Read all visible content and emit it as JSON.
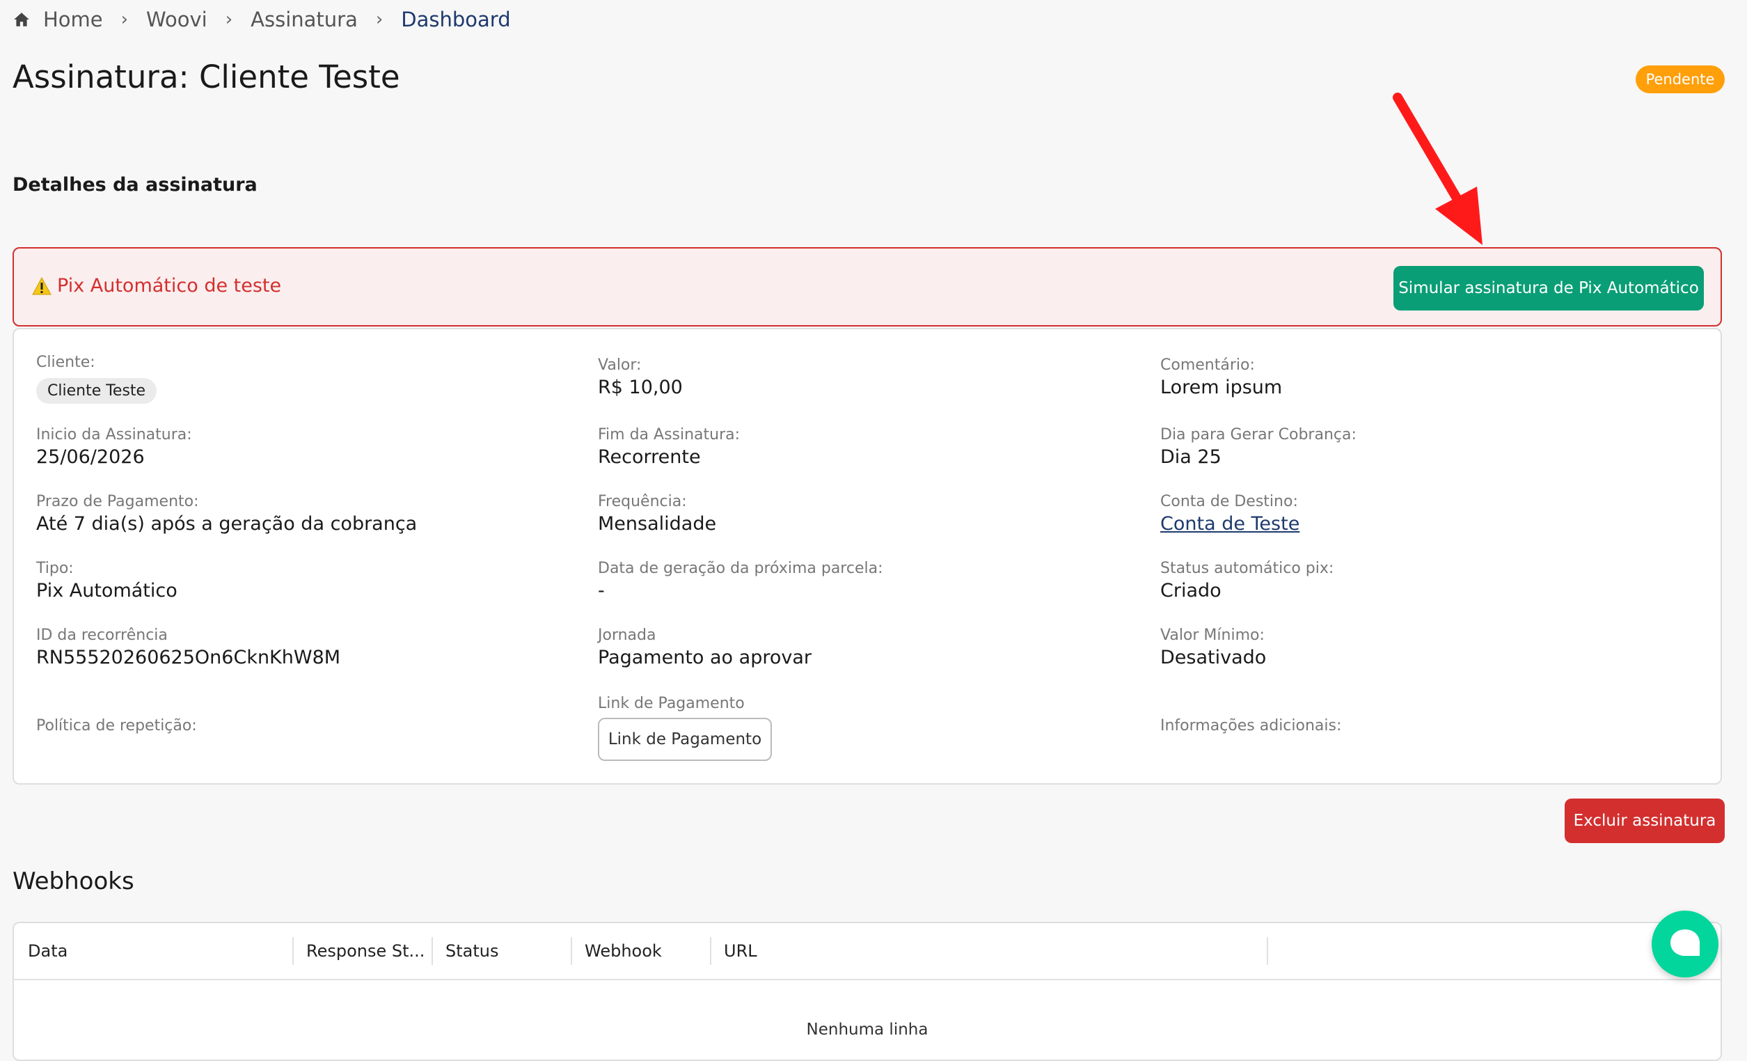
{
  "breadcrumb": {
    "items": [
      "Home",
      "Woovi",
      "Assinatura"
    ],
    "current": "Dashboard",
    "separator": "›"
  },
  "page": {
    "title": "Assinatura: Cliente Teste",
    "status_badge": "Pendente",
    "section_title": "Detalhes da assinatura"
  },
  "alert": {
    "text": "Pix Automático de teste",
    "button": "Simular assinatura de Pix Automático"
  },
  "details": {
    "cliente_label": "Cliente:",
    "cliente_value": "Cliente Teste",
    "valor_label": "Valor:",
    "valor_value": "R$ 10,00",
    "comentario_label": "Comentário:",
    "comentario_value": "Lorem ipsum",
    "inicio_label": "Inicio da Assinatura:",
    "inicio_value": "25/06/2026",
    "fim_label": "Fim da Assinatura:",
    "fim_value": "Recorrente",
    "dia_label": "Dia para Gerar Cobrança:",
    "dia_value": "Dia 25",
    "prazo_label": "Prazo de Pagamento:",
    "prazo_value": "Até 7 dia(s) após a geração da cobrança",
    "frequencia_label": "Frequência:",
    "frequencia_value": "Mensalidade",
    "conta_label": "Conta de Destino:",
    "conta_value": "Conta de Teste",
    "tipo_label": "Tipo:",
    "tipo_value": "Pix Automático",
    "proxima_label": "Data de geração da próxima parcela:",
    "proxima_value": "-",
    "status_pix_label": "Status automático pix:",
    "status_pix_value": "Criado",
    "recorrencia_label": "ID da recorrência",
    "recorrencia_value": "RN55520260625On6CknKhW8M",
    "jornada_label": "Jornada",
    "jornada_value": "Pagamento ao aprovar",
    "valor_minimo_label": "Valor Mínimo:",
    "valor_minimo_value": "Desativado",
    "politica_label": "Política de repetição:",
    "link_label": "Link de Pagamento",
    "link_button": "Link de Pagamento",
    "info_label": "Informações adicionais:"
  },
  "actions": {
    "delete_button": "Excluir assinatura"
  },
  "webhooks": {
    "title": "Webhooks",
    "columns": [
      "Data",
      "Response St...",
      "Status",
      "Webhook",
      "URL"
    ],
    "empty_text": "Nenhuma linha"
  },
  "colors": {
    "primary": "#0a9e76",
    "danger": "#d32f2f",
    "warning": "#ff9f0a",
    "link": "#1e3a6e",
    "chat": "#03d69d",
    "annotation_arrow": "#ff1a1a"
  },
  "icons": [
    "home-icon",
    "warning-icon",
    "chat-icon",
    "annotation-arrow"
  ]
}
